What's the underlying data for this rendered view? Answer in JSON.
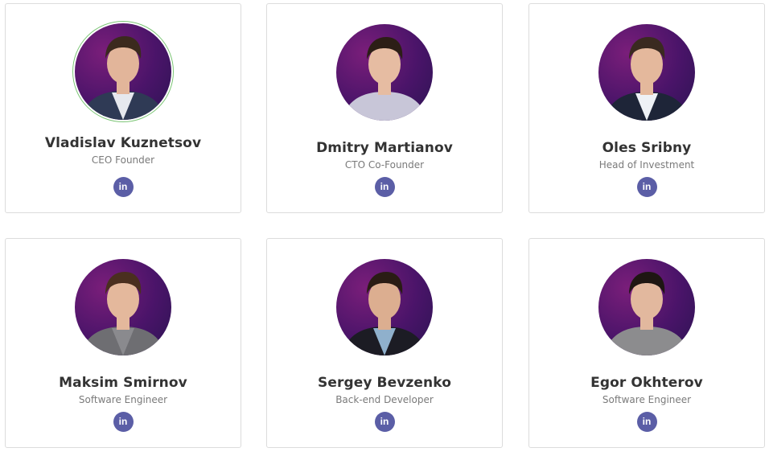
{
  "team": [
    {
      "name": "Vladislav Kuznetsov",
      "role": "CEO Founder",
      "link_icon": "linkedin-icon",
      "link_text": "in",
      "shirt": "#2f3a55",
      "inner": "#e6e8ee",
      "hair": "#3b2a1e",
      "skin": "#e2b59a",
      "highlighted": true
    },
    {
      "name": "Dmitry Martianov",
      "role": "CTO Co-Founder",
      "link_icon": "linkedin-icon",
      "link_text": "in",
      "shirt": "#c8c6d8",
      "inner": "#c8c6d8",
      "hair": "#2c1e16",
      "skin": "#e6bca2",
      "highlighted": false
    },
    {
      "name": "Oles Sribny",
      "role": "Head of Investment",
      "link_icon": "linkedin-icon",
      "link_text": "in",
      "shirt": "#1e2538",
      "inner": "#eef1f6",
      "hair": "#3a2a20",
      "skin": "#e4b89c",
      "highlighted": false
    },
    {
      "name": "Maksim Smirnov",
      "role": "Software Engineer",
      "link_icon": "linkedin-icon",
      "link_text": "in",
      "shirt": "#6e6e72",
      "inner": "#8a8a8e",
      "hair": "#4a2f1f",
      "skin": "#e4b89c",
      "highlighted": false
    },
    {
      "name": "Sergey Bevzenko",
      "role": "Back-end Developer",
      "link_icon": "linkedin-icon",
      "link_text": "in",
      "shirt": "#1c1c24",
      "inner": "#8fb0cc",
      "hair": "#2a1c14",
      "skin": "#dcae90",
      "highlighted": false
    },
    {
      "name": "Egor Okhterov",
      "role": "Software Engineer",
      "link_icon": "linkedin-icon",
      "link_text": "in",
      "shirt": "#8c8c8e",
      "inner": "#8c8c8e",
      "hair": "#1e1612",
      "skin": "#e2b89e",
      "highlighted": false
    }
  ],
  "colors": {
    "linkedin": "#5b5ea6",
    "highlight_ring": "#7cc576"
  }
}
